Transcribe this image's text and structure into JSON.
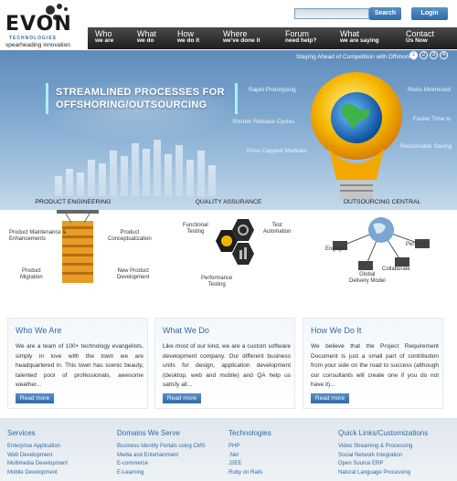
{
  "brand": {
    "name": "EVON",
    "sub": "TECHNOLOGIES",
    "tagline": "spearheading innovation"
  },
  "header": {
    "search_placeholder": "",
    "search_label": "Search",
    "login_label": "Login"
  },
  "nav": [
    {
      "title": "Who",
      "sub": "we are"
    },
    {
      "title": "What",
      "sub": "we do"
    },
    {
      "title": "How",
      "sub": "we do it"
    },
    {
      "title": "Where",
      "sub": "we've done it"
    },
    {
      "title": "Forum",
      "sub": "need help?"
    },
    {
      "title": "What",
      "sub": "we are saying"
    },
    {
      "title": "Contact",
      "sub": "Us Now"
    }
  ],
  "banner": {
    "slogan": "Staying Ahead of Competition with Offshoring",
    "pager": [
      "1",
      "2",
      "3",
      "4"
    ],
    "title_line1": "STREAMLINED PROCESSES FOR",
    "title_line2": "OFFSHORING/OUTSOURCING",
    "labels": {
      "rapid": "Rapid Prototyping",
      "risks": "Risks Minimized",
      "shorter": "Shorter Release Cycles",
      "faster": "Faster Time to",
      "price": "Price Capped Modules",
      "saving": "Reasonable Saving"
    }
  },
  "services": [
    {
      "title": "PRODUCT ENGINEERING",
      "labels": [
        "Product Maintenance &",
        "Enhancements",
        "Product",
        "Conceptualization",
        "Product",
        "Migration",
        "New Product",
        "Development"
      ]
    },
    {
      "title": "QUALITY ASSURANCE",
      "labels": [
        "Functional",
        "Testing",
        "Test",
        "Automation",
        "Performance",
        "Testing"
      ]
    },
    {
      "title": "OUTSOURCING CENTRAL",
      "labels": [
        "Engage",
        "Perform",
        "Collaborate",
        "Global",
        "Delivery Model"
      ]
    }
  ],
  "boxes": [
    {
      "title": "Who We Are",
      "text": "We are a team of 100+ technology evangelists, simply in love with the town we are headquartered in. This town has scenic beauty, talented pool of professionals, awesome weather...",
      "more": "Read more"
    },
    {
      "title": "What We Do",
      "text": "Like most of our kind, we are a custom software development company. Our different business units for design, application development (desktop, web and mobile) and QA help us satisfy all...",
      "more": "Read more"
    },
    {
      "title": "How We Do It",
      "text": "We believe that the Project Requirement Document is just a small part of contribution from your side on the road to success (although our consultants will create one if you do not have it)...",
      "more": "Read more"
    }
  ],
  "footer": [
    {
      "title": "Services",
      "links": [
        "Enterprise Application",
        "Web Development",
        "Multimedia Development",
        "Mobile Development"
      ]
    },
    {
      "title": "Domains We Serve",
      "links": [
        "Business Identity Portals using CMS",
        "Media and Entertainment",
        "E-commerce",
        "E-Learning"
      ]
    },
    {
      "title": "Technologies",
      "links": [
        "PHP",
        ".Net",
        "J2EE",
        "Ruby on Rails"
      ]
    },
    {
      "title": "Quick Links/Customizations",
      "links": [
        "Video Streaming & Processing",
        "Social Network Integration",
        "Open Source ERP",
        "Natural Language Processing"
      ]
    }
  ]
}
